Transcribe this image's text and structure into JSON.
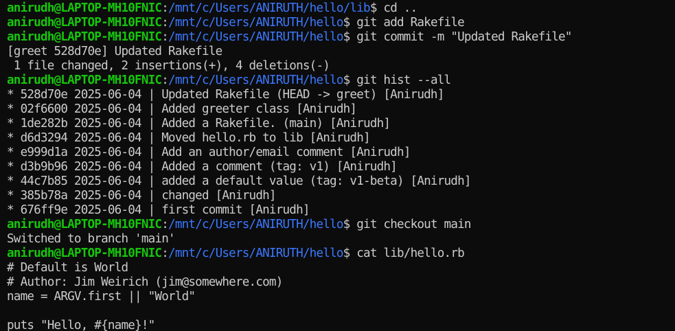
{
  "colors": {
    "background": "#0c0c0c",
    "foreground": "#cccccc",
    "prompt_user": "#16c60c",
    "prompt_path": "#3b78ff"
  },
  "lines": [
    {
      "kind": "prompt",
      "user": "anirudh@LAPTOP-MH10FNIC",
      "path": "/mnt/c/Users/ANIRUTH/hello/lib",
      "cmd": "cd .."
    },
    {
      "kind": "prompt",
      "user": "anirudh@LAPTOP-MH10FNIC",
      "path": "/mnt/c/Users/ANIRUTH/hello",
      "cmd": "git add Rakefile"
    },
    {
      "kind": "prompt",
      "user": "anirudh@LAPTOP-MH10FNIC",
      "path": "/mnt/c/Users/ANIRUTH/hello",
      "cmd": "git commit -m \"Updated Rakefile\""
    },
    {
      "kind": "output",
      "text": "[greet 528d70e] Updated Rakefile"
    },
    {
      "kind": "output",
      "text": " 1 file changed, 2 insertions(+), 4 deletions(-)"
    },
    {
      "kind": "prompt",
      "user": "anirudh@LAPTOP-MH10FNIC",
      "path": "/mnt/c/Users/ANIRUTH/hello",
      "cmd": "git hist --all"
    },
    {
      "kind": "output",
      "text": "* 528d70e 2025-06-04 | Updated Rakefile (HEAD -> greet) [Anirudh]"
    },
    {
      "kind": "output",
      "text": "* 02f6600 2025-06-04 | Added greeter class [Anirudh]"
    },
    {
      "kind": "output",
      "text": "* 1de282b 2025-06-04 | Added a Rakefile. (main) [Anirudh]"
    },
    {
      "kind": "output",
      "text": "* d6d3294 2025-06-04 | Moved hello.rb to lib [Anirudh]"
    },
    {
      "kind": "output",
      "text": "* e999d1a 2025-06-04 | Add an author/email comment [Anirudh]"
    },
    {
      "kind": "output",
      "text": "* d3b9b96 2025-06-04 | Added a comment (tag: v1) [Anirudh]"
    },
    {
      "kind": "output",
      "text": "* 44c7b85 2025-06-04 | added a default value (tag: v1-beta) [Anirudh]"
    },
    {
      "kind": "output",
      "text": "* 385b78a 2025-06-04 | changed [Anirudh]"
    },
    {
      "kind": "output",
      "text": "* 676ff9e 2025-06-04 | first commit [Anirudh]"
    },
    {
      "kind": "prompt",
      "user": "anirudh@LAPTOP-MH10FNIC",
      "path": "/mnt/c/Users/ANIRUTH/hello",
      "cmd": "git checkout main"
    },
    {
      "kind": "output",
      "text": "Switched to branch 'main'"
    },
    {
      "kind": "prompt",
      "user": "anirudh@LAPTOP-MH10FNIC",
      "path": "/mnt/c/Users/ANIRUTH/hello",
      "cmd": "cat lib/hello.rb"
    },
    {
      "kind": "output",
      "text": "# Default is World"
    },
    {
      "kind": "output",
      "text": "# Author: Jim Weirich (jim@somewhere.com)"
    },
    {
      "kind": "output",
      "text": "name = ARGV.first || \"World\""
    },
    {
      "kind": "output",
      "text": ""
    },
    {
      "kind": "output",
      "text": "puts \"Hello, #{name}!\""
    }
  ]
}
